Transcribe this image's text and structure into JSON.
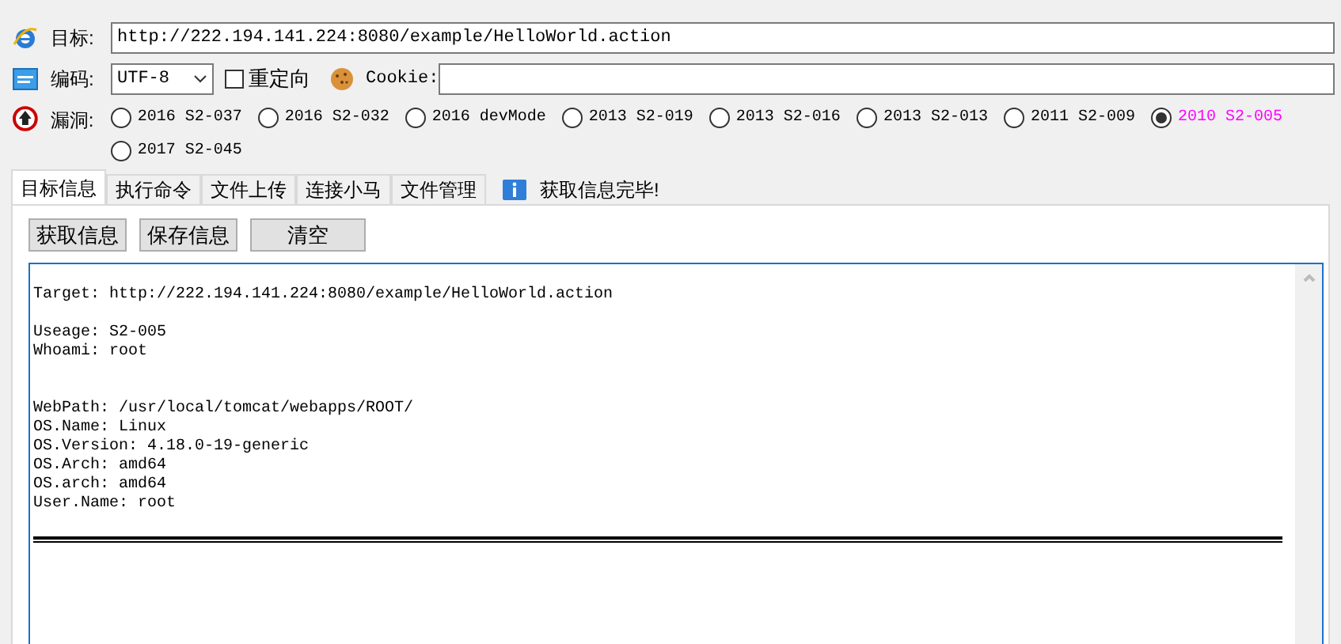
{
  "target": {
    "label": "目标:",
    "value": "http://222.194.141.224:8080/example/HelloWorld.action"
  },
  "encoding": {
    "label": "编码:",
    "value": "UTF-8"
  },
  "redirect": {
    "label": "重定向",
    "checked": false
  },
  "cookie": {
    "label": "Cookie:"
  },
  "vulns": {
    "label": "漏洞:",
    "options": [
      {
        "label": "2016 S2-037",
        "selected": false
      },
      {
        "label": "2016 S2-032",
        "selected": false
      },
      {
        "label": "2016 devMode",
        "selected": false
      },
      {
        "label": "2013 S2-019",
        "selected": false
      },
      {
        "label": "2013 S2-016",
        "selected": false
      },
      {
        "label": "2013 S2-013",
        "selected": false
      },
      {
        "label": "2011 S2-009",
        "selected": false
      },
      {
        "label": "2010 S2-005",
        "selected": true
      },
      {
        "label": "2017 S2-045",
        "selected": false
      }
    ]
  },
  "tabs": [
    {
      "label": "目标信息",
      "selected": true
    },
    {
      "label": "执行命令",
      "selected": false
    },
    {
      "label": "文件上传",
      "selected": false
    },
    {
      "label": "连接小马",
      "selected": false
    },
    {
      "label": "文件管理",
      "selected": false
    }
  ],
  "status": "获取信息完毕!",
  "buttons": [
    "获取信息",
    "保存信息",
    "清空"
  ],
  "output": "\nTarget: http://222.194.141.224:8080/example/HelloWorld.action\n\nUseage: S2-005\nWhoami: root\n\n\nWebPath: /usr/local/tomcat/webapps/ROOT/\nOS.Name: Linux\nOS.Version: 4.18.0-19-generic\nOS.Arch: amd64\nOS.arch: amd64\nUser.Name: root"
}
